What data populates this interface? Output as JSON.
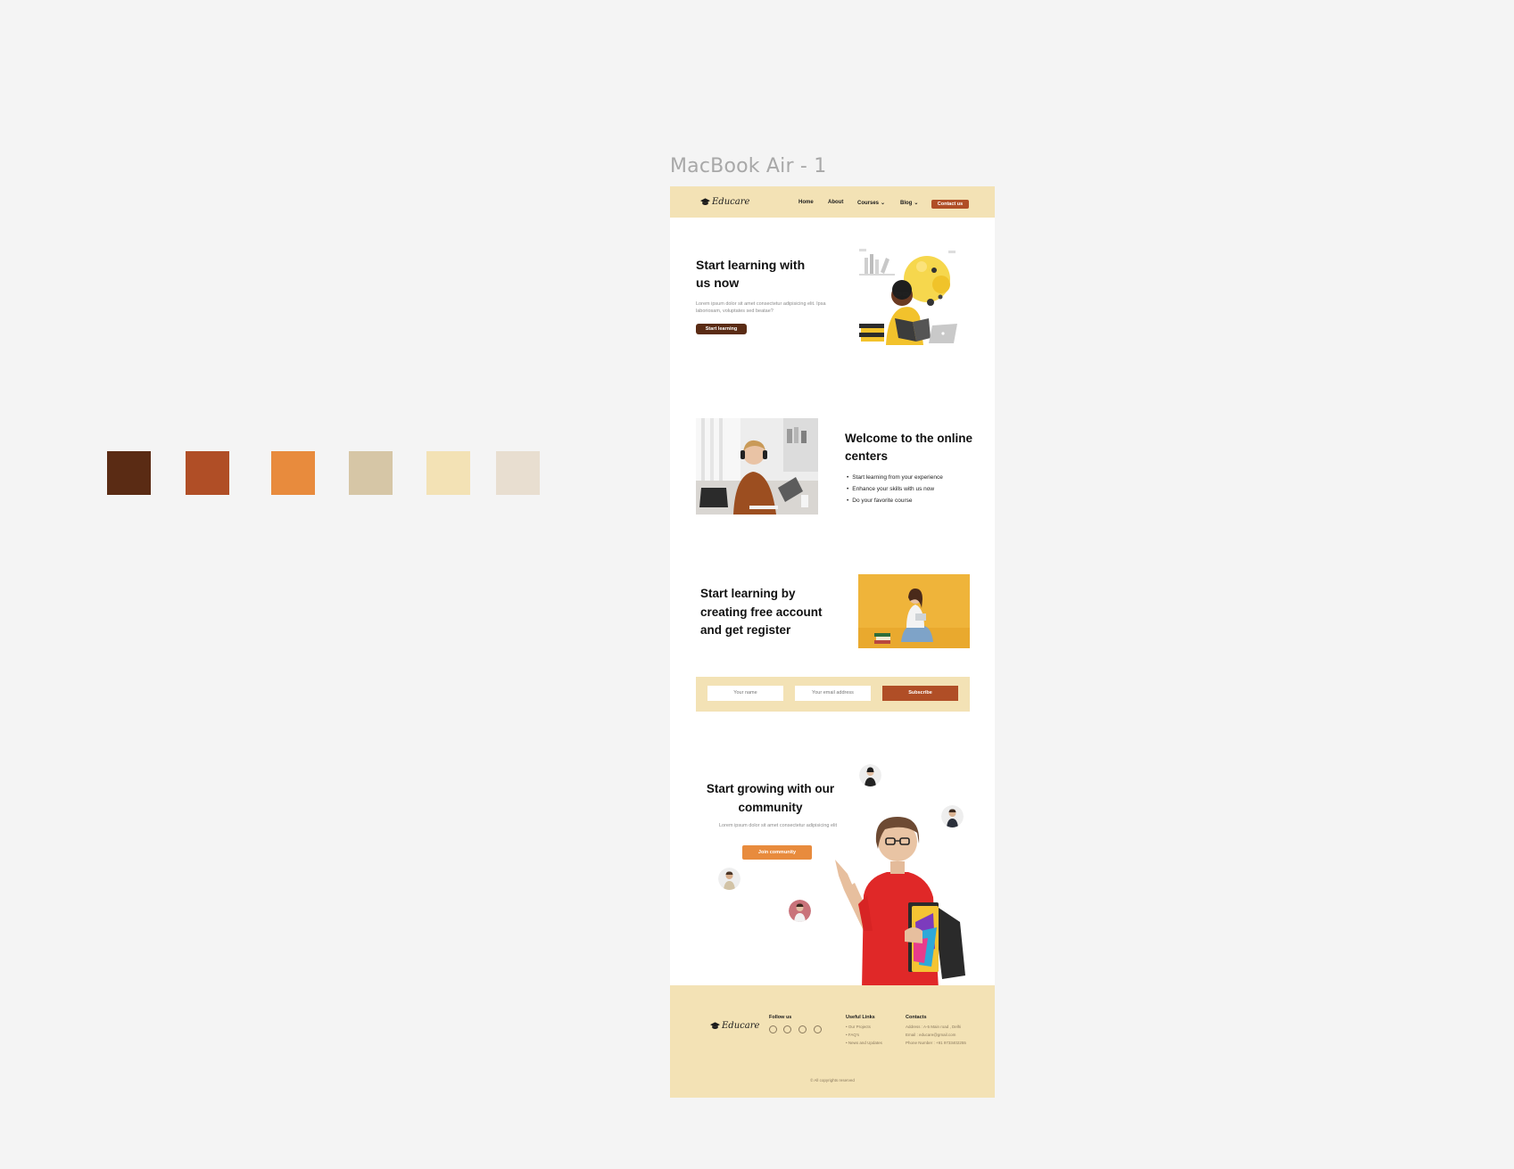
{
  "frame": {
    "label": "MacBook Air - 1"
  },
  "palette": [
    "#5a2b14",
    "#b04e26",
    "#e88b3d",
    "#d6c6a6",
    "#f3e2b5",
    "#e8ded0"
  ],
  "brand": {
    "name": "Educare"
  },
  "nav": {
    "home": "Home",
    "about": "About",
    "courses": "Courses",
    "blog": "Blog",
    "contact": "Contact us"
  },
  "hero": {
    "title": "Start learning with us now",
    "subtitle": "Lorem ipsum dolor sit amet consectetur adipisicing elit. Ipsa laboriosam, voluptates sed beatae?",
    "cta": "Start learning"
  },
  "welcome": {
    "title": "Welcome to the online centers",
    "bullets": [
      "Start learning from your experience",
      "Enhance your skills with us now",
      "Do your favorite course"
    ]
  },
  "register": {
    "title": "Start learning by creating free account and get register"
  },
  "subscribe": {
    "name_placeholder": "Your name",
    "email_placeholder": "Your email address",
    "button": "Subscribe"
  },
  "community": {
    "title": "Start growing with our community",
    "subtitle": "Lorem ipsum dolor sit amet consectetur adipisicing elit",
    "cta": "Join community"
  },
  "footer": {
    "follow_title": "Follow us",
    "social_icons": [
      "linkedin-icon",
      "youtube-icon",
      "facebook-icon",
      "instagram-icon"
    ],
    "links_title": "Useful Links",
    "links": [
      "Our Projects",
      "FAQ's",
      "News and Updates"
    ],
    "contacts_title": "Contacts",
    "contacts": [
      "Address : A-5 Main road , Delhi",
      "Email : educare@gmail.com",
      "Phone Number : +91 9733402255"
    ],
    "copyright": "All copyrights reserved"
  }
}
